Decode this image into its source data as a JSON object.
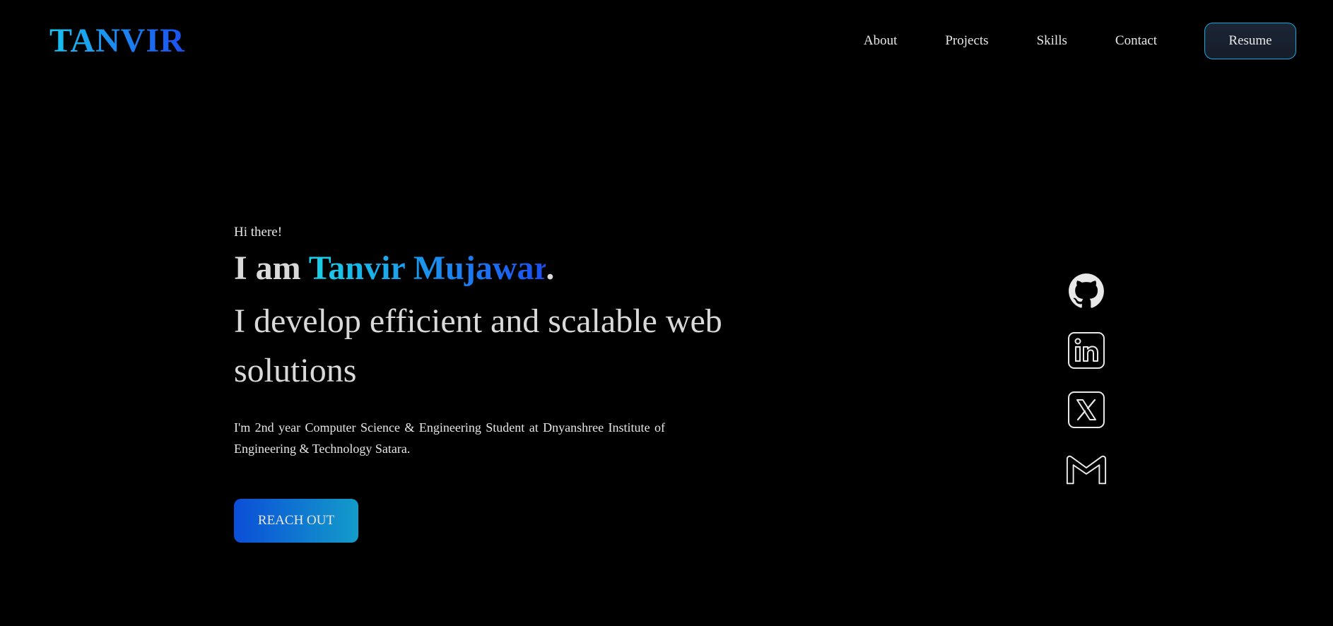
{
  "header": {
    "logo": "TANVIR",
    "nav": [
      {
        "label": "About"
      },
      {
        "label": "Projects"
      },
      {
        "label": "Skills"
      },
      {
        "label": "Contact"
      }
    ],
    "resume_label": "Resume"
  },
  "hero": {
    "greeting": "Hi there!",
    "intro_prefix": "I am ",
    "name": "Tanvir Mujawar",
    "intro_suffix": ".",
    "tagline": "I develop efficient and scalable web solutions",
    "description": "I'm 2nd year Computer Science & Engineering Student at Dnyanshree Institute of Engineering & Technology Satara.",
    "cta_label": "REACH OUT"
  },
  "social": [
    {
      "icon": "github-icon"
    },
    {
      "icon": "linkedin-icon"
    },
    {
      "icon": "x-icon"
    },
    {
      "icon": "gmail-icon"
    }
  ],
  "colors": {
    "background": "#000000",
    "accent_cyan": "#1ad2e6",
    "accent_blue": "#1b4ff0",
    "text": "#e6e6e6"
  }
}
